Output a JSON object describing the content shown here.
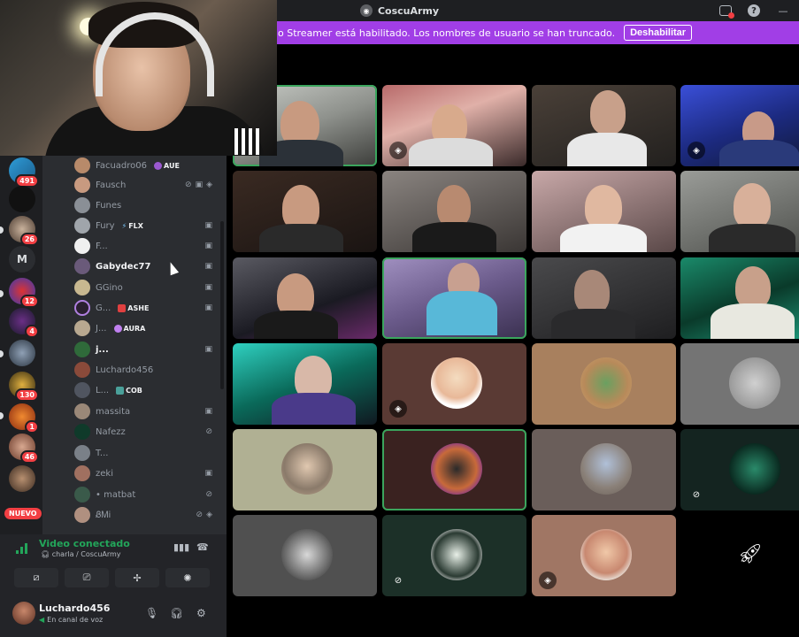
{
  "titlebar": {
    "title": "CoscuArmy",
    "server_icon": "server-icon",
    "inbox_icon": "inbox-icon",
    "help_icon": "help-icon",
    "minimize_icon": "minimize-icon"
  },
  "banner": {
    "text": "o Streamer está habilitado. Los nombres de usuario se han truncado.",
    "button_label": "Deshabilitar",
    "color": "#a13ee6"
  },
  "rail": {
    "letter_server": "M",
    "badges": [
      "491",
      "26",
      "12",
      "4",
      "130",
      "1",
      "46"
    ],
    "nuevo": "NUEVO"
  },
  "members": [
    {
      "name": "Facuadro06",
      "tag": "AUE",
      "icons": ""
    },
    {
      "name": "Fausch",
      "tag": "",
      "icons": "mic-off video screen"
    },
    {
      "name": "Funes",
      "tag": "",
      "icons": ""
    },
    {
      "name": "Fury",
      "tag": "FLX",
      "icons": "video"
    },
    {
      "name": "F...",
      "tag": "",
      "icons": "video"
    },
    {
      "name": "Gabydec77",
      "tag": "",
      "icons": "video"
    },
    {
      "name": "GGino",
      "tag": "",
      "icons": "video"
    },
    {
      "name": "G...",
      "tag": "ASHE",
      "icons": "video"
    },
    {
      "name": "J...",
      "tag": "AURA",
      "icons": ""
    },
    {
      "name": "j...",
      "tag": "",
      "icons": "video"
    },
    {
      "name": "Luchardo456",
      "tag": "",
      "icons": ""
    },
    {
      "name": "L...",
      "tag": "COB",
      "icons": ""
    },
    {
      "name": "massita",
      "tag": "",
      "icons": "video"
    },
    {
      "name": "Nafezz",
      "tag": "",
      "icons": "mic-off"
    },
    {
      "name": "T...",
      "tag": "",
      "icons": ""
    },
    {
      "name": "zeki",
      "tag": "",
      "icons": "video"
    },
    {
      "name": "• matbat",
      "tag": "",
      "icons": "mic-off"
    },
    {
      "name": "ᏰᎷi",
      "tag": "",
      "icons": "mic-off screen"
    }
  ],
  "voice": {
    "status": "Video conectado",
    "channel": "charla / CoscuArmy"
  },
  "user": {
    "name": "Luchardo456",
    "status": "En canal de voz"
  },
  "colors": {
    "speaking": "#3ba55d",
    "badge": "#f23f43",
    "sidebar": "#2b2d31",
    "rail": "#1e1f22"
  }
}
